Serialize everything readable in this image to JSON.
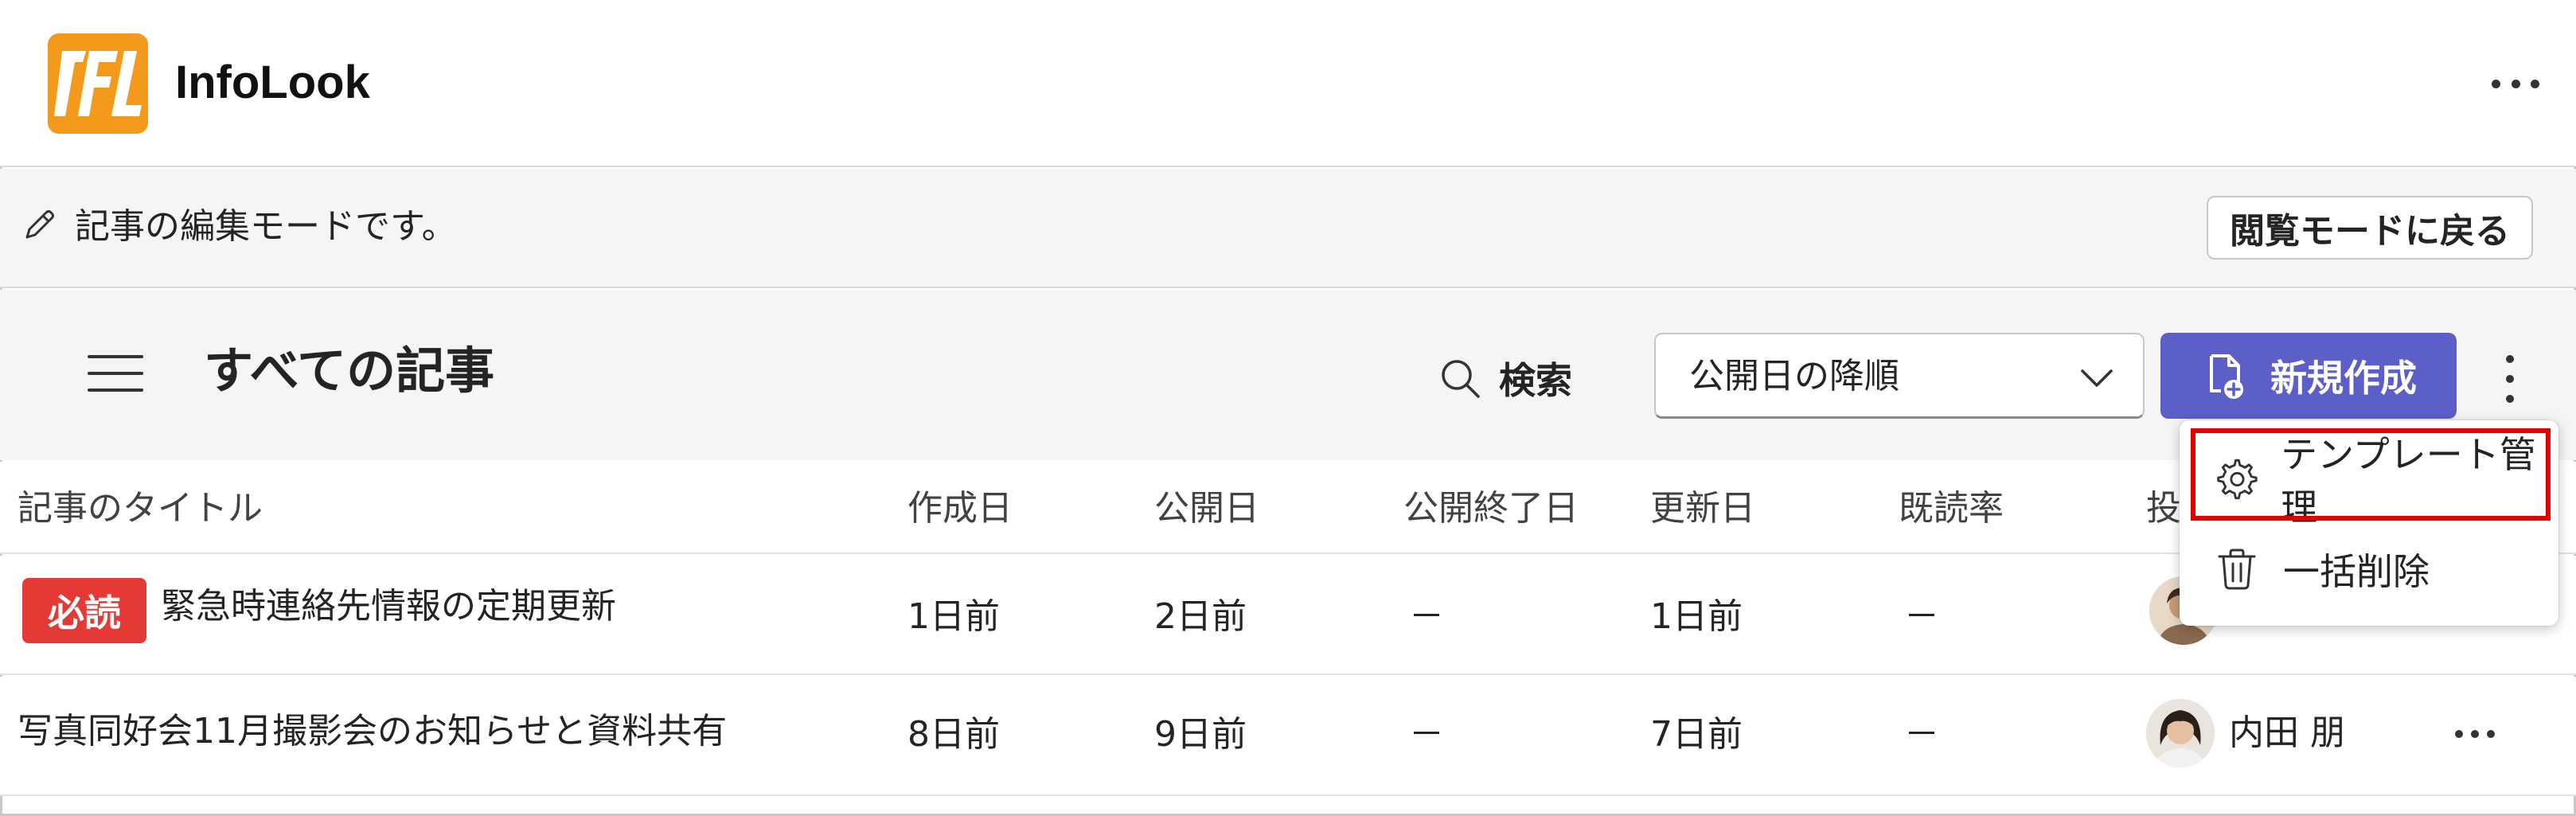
{
  "app": {
    "name": "InfoLook",
    "brand_color": "#f39a1d"
  },
  "edit_bar": {
    "message": "記事の編集モードです。",
    "back_button": "閲覧モードに戻る"
  },
  "toolbar": {
    "title": "すべての記事",
    "search_label": "検索",
    "sort_value": "公開日の降順",
    "new_button": "新規作成",
    "accent_color": "#5b5fc7"
  },
  "table": {
    "columns": [
      "記事のタイトル",
      "作成日",
      "公開日",
      "公開終了日",
      "更新日",
      "既読率",
      "投"
    ],
    "rows": [
      {
        "badge": "必読",
        "title": "緊急時連絡先情報の定期更新",
        "created": "1日前",
        "published": "2日前",
        "unpublish": "－",
        "updated": "1日前",
        "read_rate": "－",
        "author": ""
      },
      {
        "badge": "",
        "title": "写真同好会11月撮影会のお知らせと資料共有",
        "created": "8日前",
        "published": "9日前",
        "unpublish": "－",
        "updated": "7日前",
        "read_rate": "－",
        "author": "内田 朋"
      }
    ]
  },
  "menu": {
    "items": [
      {
        "label": "テンプレート管理",
        "icon": "gear-icon",
        "highlighted": true
      },
      {
        "label": "一括削除",
        "icon": "trash-icon",
        "highlighted": false
      }
    ]
  }
}
